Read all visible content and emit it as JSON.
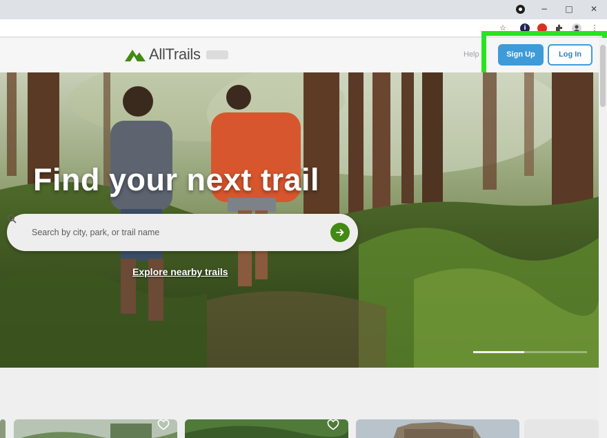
{
  "browser": {
    "window_controls": {
      "minimize": "−",
      "maximize": "□",
      "close": "✕"
    },
    "toolbar_icons": [
      "star-icon",
      "info-extension-icon",
      "record-extension-icon",
      "puzzle-extensions-icon",
      "profile-icon",
      "menu-kebab-icon"
    ]
  },
  "site": {
    "logo_text": "AllTrails",
    "header": {
      "help_label": "Help",
      "signup_label": "Sign Up",
      "login_label": "Log In"
    },
    "hero": {
      "title": "Find your next trail",
      "search_placeholder": "Search by city, park, or trail name",
      "explore_label": "Explore nearby trails",
      "carousel_progress": 0.45
    },
    "cards": [
      {
        "icon": "heart-icon"
      },
      {
        "icon": "heart-icon"
      },
      {
        "icon": "image"
      }
    ]
  },
  "colors": {
    "accent_blue": "#3e9bd8",
    "brand_green": "#428a13",
    "highlight_green": "#29e31f"
  }
}
